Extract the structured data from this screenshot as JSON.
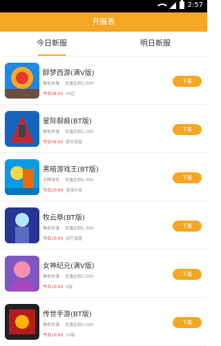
{
  "status": {
    "time": "2:57",
    "left_text": ""
  },
  "header": {
    "title": "开服表"
  },
  "tabs": {
    "today": "今日新服",
    "tomorrow": "明日新服"
  },
  "theme": {
    "accent": "#f5a623",
    "time_red": "#e53935"
  },
  "games": [
    {
      "name": "醉梦西游(满V版)",
      "genre": "角色扮演",
      "ratio": "充值比例1:500",
      "open_time": "今日08:50",
      "server": "39区",
      "download": "下载",
      "thumb_colors": [
        "#e53935",
        "#f9a825",
        "#1e88e5"
      ],
      "thumb_icon": "game-1-thumbnail-icon"
    },
    {
      "name": "星际裂痕(BT版)",
      "genre": "角色扮演",
      "ratio": "充值比例1:200",
      "open_time": "今日09:50",
      "server": "星际穿越",
      "download": "下载",
      "thumb_colors": [
        "#1565c0",
        "#c62828",
        "#37474f"
      ],
      "thumb_icon": "game-2-thumbnail-icon"
    },
    {
      "name": "黑暗游戏王(BT版)",
      "genre": "卡牌游戏",
      "ratio": "充值比例1:300",
      "open_time": "今日10:00",
      "server": "漫漫长夜",
      "download": "下载",
      "thumb_colors": [
        "#039be5",
        "#ffd54f",
        "#ef6c00"
      ],
      "thumb_icon": "game-3-thumbnail-icon"
    },
    {
      "name": "牧云祭(BT版)",
      "genre": "角色扮演",
      "ratio": "充值比例1:300",
      "open_time": "今日10:00",
      "server": "战不旋踵",
      "download": "下载",
      "thumb_colors": [
        "#5c6bc0",
        "#b3e5fc",
        "#283593"
      ],
      "thumb_icon": "game-4-thumbnail-icon"
    },
    {
      "name": "女神纪元(满V版)",
      "genre": "角色扮演",
      "ratio": "充值比例1:500",
      "open_time": "今日10:00",
      "server": "9服",
      "download": "下载",
      "thumb_colors": [
        "#ab47bc",
        "#f48fb1",
        "#7e57c2"
      ],
      "thumb_icon": "game-5-thumbnail-icon"
    },
    {
      "name": "传世手游(BT版)",
      "genre": "角色扮演",
      "ratio": "充值比例1:500",
      "open_time": "今日10:00",
      "server": "10服",
      "download": "下载",
      "thumb_colors": [
        "#212121",
        "#b71c1c",
        "#ffb300"
      ],
      "thumb_icon": "game-6-thumbnail-icon"
    }
  ]
}
